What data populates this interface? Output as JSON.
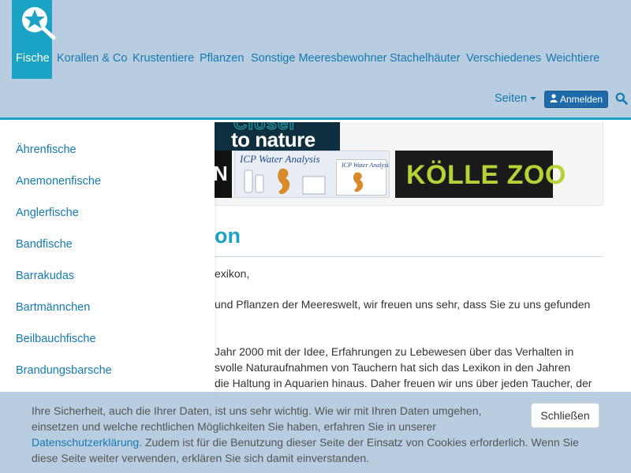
{
  "navbar": {
    "active_category": "Fische",
    "categories": [
      "Korallen & Co",
      "Krustentiere",
      "Pflanzen",
      "Sonstige Meeresbewohner",
      "Stachelhäuter",
      "Verschiedenes",
      "Weichtiere"
    ],
    "pages_label": "Seiten",
    "login_label": "Anmelden"
  },
  "banners": {
    "nature_top": "Closer",
    "nature_main": "to nature",
    "dark_letter": "N",
    "icp_title": "ICP Water Analysis",
    "icp_box_title": "ICP Water Analysis",
    "kolle": "KÖLLE ZOO"
  },
  "main": {
    "heading": "on",
    "paragraphs": [
      "exikon,",
      "und Pflanzen der Meereswelt, wir freuen uns sehr, dass Sie zu uns gefunden",
      "Jahr 2000 mit der Idee, Erfahrungen zu Lebewesen über das Verhalten in",
      "svolle Naturaufnahmen von Tauchern hat sich das Lexikon in den Jahren",
      "die Haltung in Aquarien hinaus. Daher freuen wir uns über jeden Taucher, der"
    ]
  },
  "sidebar": {
    "items": [
      "Ährenfische",
      "Anemonenfische",
      "Anglerfische",
      "Bandfische",
      "Barrakudas",
      "Bartmännchen",
      "Beilbauchfische",
      "Brandungsbarsche"
    ]
  },
  "cookie": {
    "line1": "Ihre Sicherheit, auch die Ihrer Daten, ist uns sehr wichtig. Wie wir mit Ihren Daten umgehen,",
    "line2": "einsetzen und welche rechtlichen Möglichkeiten Sie haben, erfahren Sie in unserer",
    "link": "Datenschutzerklärung",
    "line3_rest": ". Zudem ist für die Benutzung dieser Seite der Einsatz von Cookies erforderlich. Wenn Sie",
    "line4": "diese Seite weiter verwenden, erklären Sie sich damit einverstanden.",
    "close_label": "Schließen"
  },
  "colors": {
    "accent": "#1aa3c4",
    "navbar_bg": "#b8cde0",
    "link": "#157ab0",
    "login_bg": "#1f6aa8"
  },
  "icons": [
    "star-magnifier-logo-icon",
    "user-icon",
    "search-icon",
    "caret-down-icon"
  ]
}
